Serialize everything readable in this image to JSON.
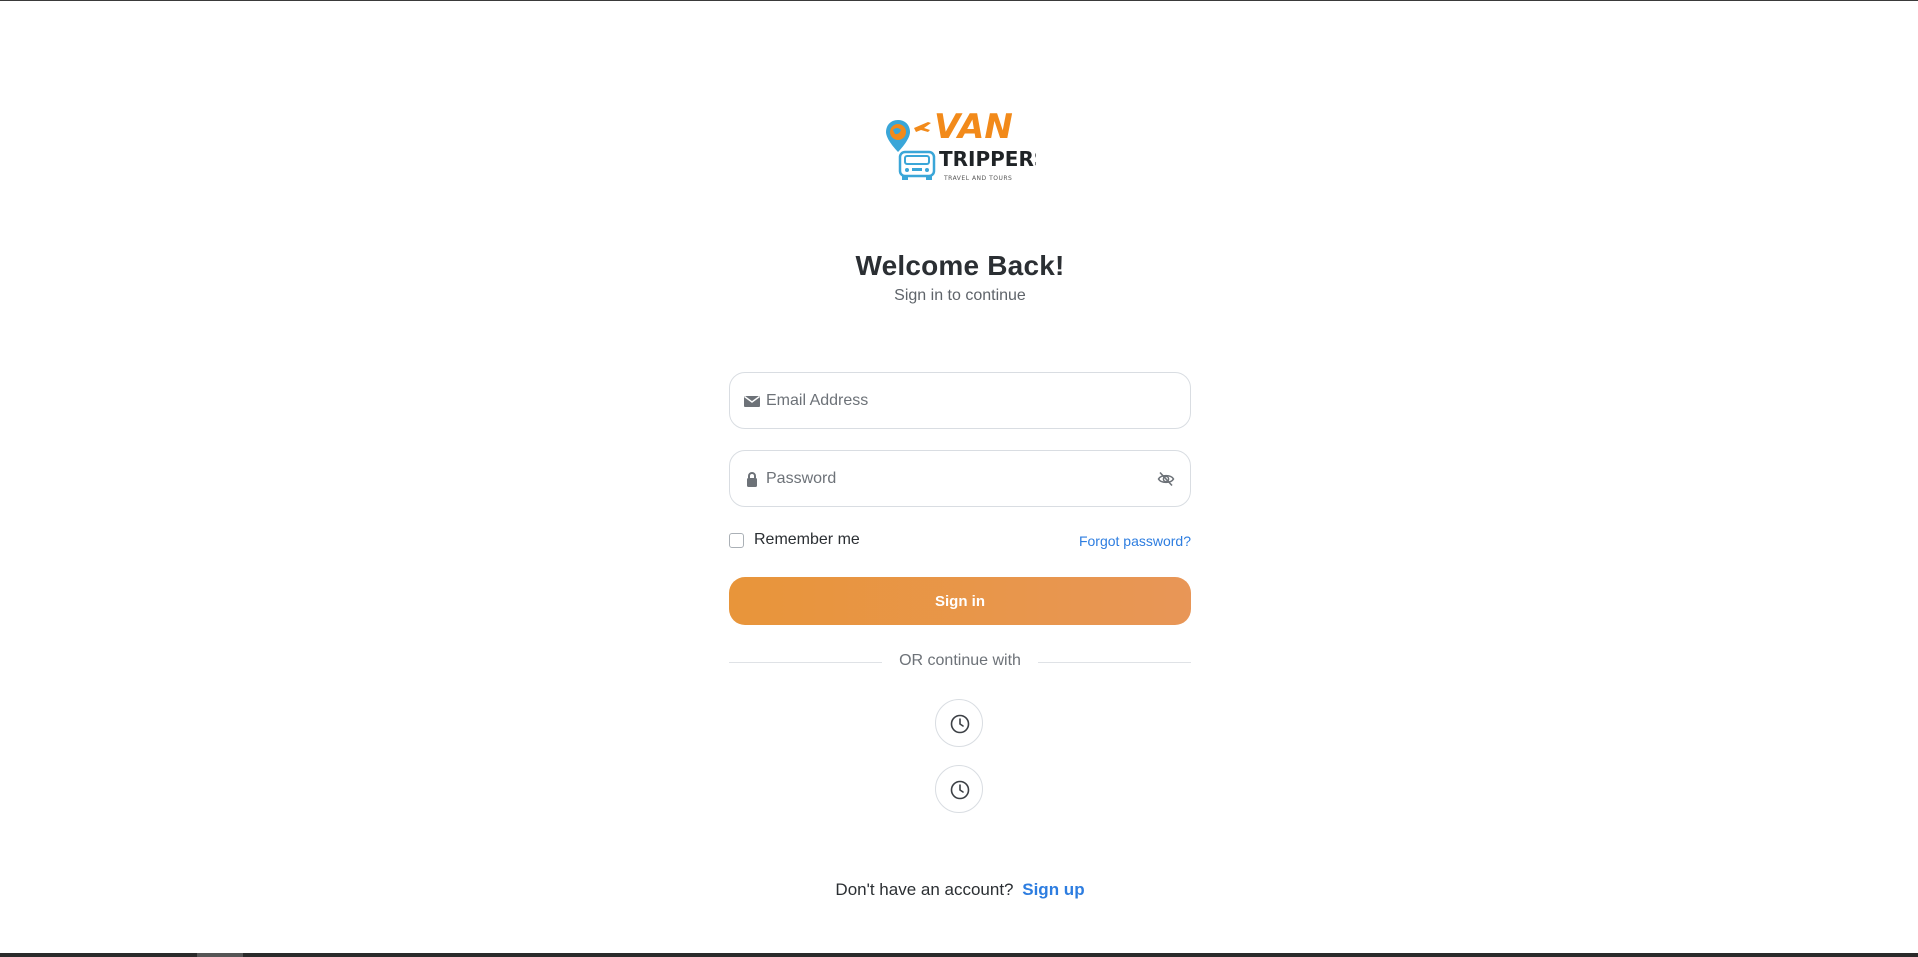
{
  "brand": {
    "logo_line1": "VAN",
    "logo_line2": "TRIPPERS",
    "logo_tagline": "TRAVEL AND TOURS",
    "primary_color": "#f28a1a",
    "secondary_color": "#3aa6d8"
  },
  "header": {
    "title": "Welcome Back!",
    "subtitle": "Sign in to continue"
  },
  "form": {
    "email": {
      "placeholder": "Email Address",
      "value": "",
      "icon": "envelope-icon"
    },
    "password": {
      "placeholder": "Password",
      "value": "",
      "icon": "lock-icon",
      "toggle_icon": "eye-off-icon"
    },
    "remember_label": "Remember me",
    "remember_checked": false,
    "forgot_label": "Forgot password?",
    "submit_label": "Sign in",
    "submit_color": "#e8953a"
  },
  "divider": {
    "label": "OR continue with"
  },
  "social_buttons": [
    {
      "icon": "clock-icon"
    },
    {
      "icon": "clock-icon"
    }
  ],
  "footer": {
    "prompt": "Don't have an account?",
    "signup_label": "Sign up",
    "link_color": "#2d7de0"
  }
}
